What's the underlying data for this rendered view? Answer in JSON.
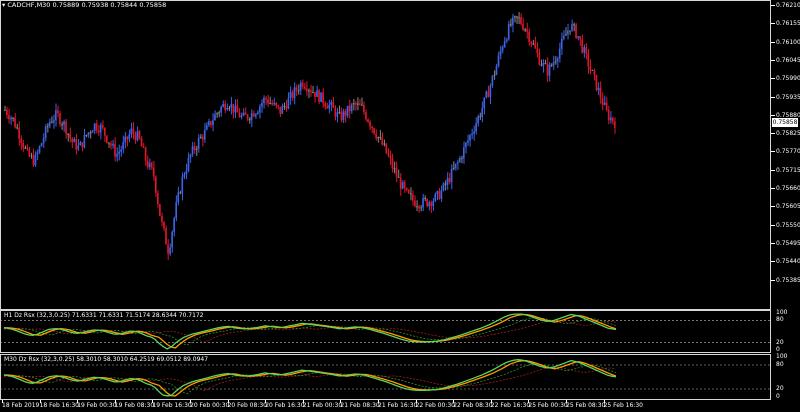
{
  "chart": {
    "symbol_line": "CADCHF,M30  0.75889 0.75938 0.75844 0.75858",
    "current_price": "0.75858",
    "colors": {
      "bull": "#3d63e8",
      "bear": "#e0162b",
      "neutral": "#8a8a8a",
      "background": "#000000",
      "grid": "#d8d8d8"
    },
    "price_labels": [
      "0.76210",
      "0.76155",
      "0.76100",
      "0.76045",
      "0.75990",
      "0.75935",
      "0.75880",
      "0.75825",
      "0.75770",
      "0.75715",
      "0.75660",
      "0.75605",
      "0.75550",
      "0.75495",
      "0.75440",
      "0.75385"
    ]
  },
  "indicator1": {
    "title": "H1 Dz Rsx (32,3,0.25) 71.6331 71.6331 71.5174 28.6344 70.7172",
    "levels": [
      "100",
      "80",
      "20",
      "0"
    ]
  },
  "indicator2": {
    "title": "M30 Dz Rsx (32,3,0.25) 58.3010 58.3010 64.2519 69.0512 89.0947",
    "levels": [
      "100",
      "80",
      "20",
      "0"
    ]
  },
  "time_labels": [
    "18 Feb 2019",
    "18 Feb 16:30",
    "19 Feb 00:30",
    "19 Feb 08:30",
    "19 Feb 16:30",
    "20 Feb 00:30",
    "20 Feb 08:30",
    "20 Feb 16:30",
    "21 Feb 00:30",
    "21 Feb 08:30",
    "21 Feb 16:30",
    "22 Feb 00:30",
    "22 Feb 08:30",
    "22 Feb 16:30",
    "25 Feb 00:30",
    "25 Feb 08:30",
    "25 Feb 16:30"
  ],
  "chart_data": {
    "type": "candlestick",
    "close_path": [
      0.75895,
      0.7587,
      0.7582,
      0.7576,
      0.7574,
      0.758,
      0.7586,
      0.7588,
      0.7585,
      0.758,
      0.7578,
      0.7582,
      0.7585,
      0.7584,
      0.758,
      0.7576,
      0.7579,
      0.7583,
      0.7581,
      0.7574,
      0.757,
      0.7556,
      0.7547,
      0.756,
      0.757,
      0.7576,
      0.758,
      0.7583,
      0.7587,
      0.759,
      0.7592,
      0.7589,
      0.7587,
      0.7588,
      0.759,
      0.7593,
      0.7591,
      0.7589,
      0.7592,
      0.7595,
      0.7598,
      0.7596,
      0.7594,
      0.7592,
      0.759,
      0.7587,
      0.7589,
      0.7591,
      0.759,
      0.7586,
      0.7582,
      0.7578,
      0.7573,
      0.7568,
      0.7564,
      0.7562,
      0.75615,
      0.7562,
      0.7563,
      0.7566,
      0.757,
      0.7574,
      0.7579,
      0.7584,
      0.7589,
      0.7595,
      0.7602,
      0.761,
      0.7615,
      0.7617,
      0.7614,
      0.7609,
      0.7604,
      0.7601,
      0.7605,
      0.761,
      0.7615,
      0.7612,
      0.7606,
      0.76,
      0.7594,
      0.7588,
      0.75858
    ],
    "levels": [
      20,
      80
    ]
  }
}
